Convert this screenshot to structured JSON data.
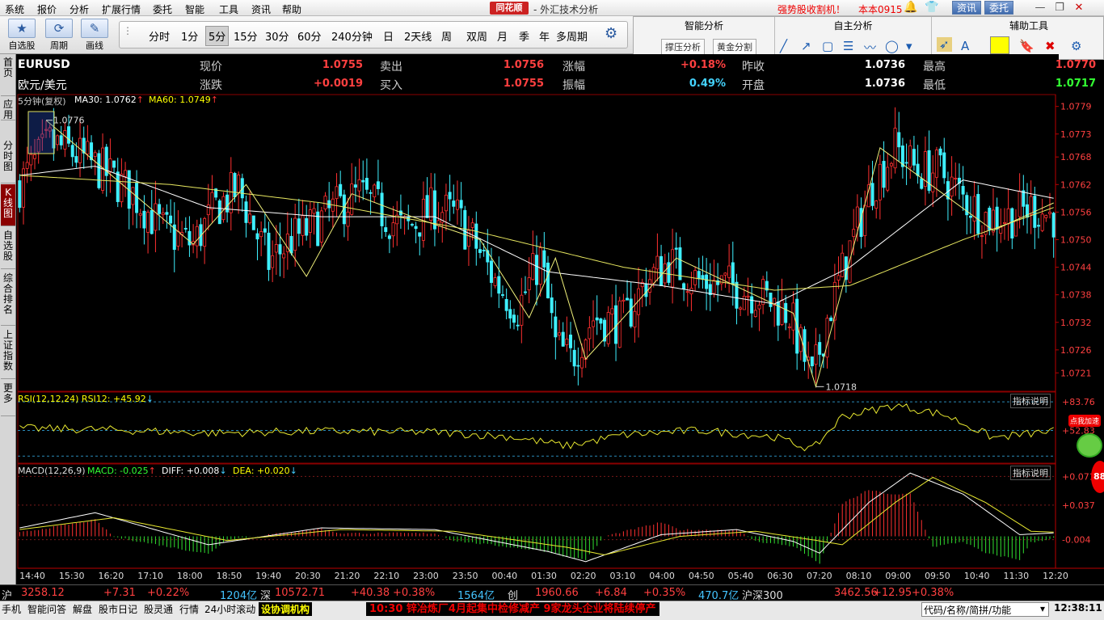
{
  "menu": [
    "系统",
    "报价",
    "分析",
    "扩展行情",
    "委托",
    "智能",
    "工具",
    "资讯",
    "帮助"
  ],
  "brand": "同花顺",
  "window_title": "- 外汇技术分析",
  "promo": "强势股收割机！",
  "version": "本本0915",
  "top_buttons": [
    "资讯",
    "委托"
  ],
  "toolbar": {
    "self_select": "自选股",
    "cycle": "周期",
    "draw": "画线"
  },
  "periods": [
    "分时",
    "1分",
    "5分",
    "15分",
    "30分",
    "60分",
    "240分钟",
    "日",
    "2天线",
    "周",
    "双周",
    "月",
    "季",
    "年",
    "多周期"
  ],
  "active_period": "5分",
  "panels": {
    "smart": "智能分析",
    "smart_btns": [
      "撑压分析",
      "黄金分割"
    ],
    "self": "自主分析",
    "aux": "辅助工具"
  },
  "sidetabs": [
    "首页",
    "应用",
    "分时图",
    "K线图",
    "自选股",
    "综合排名",
    "上证指数",
    "更多"
  ],
  "quote": {
    "code": "EURUSD",
    "name": "欧元/美元",
    "row1": [
      [
        "现价",
        "1.0755"
      ],
      [
        "卖出",
        "1.0756"
      ],
      [
        "涨幅",
        "+0.18%"
      ],
      [
        "昨收",
        "1.0736"
      ],
      [
        "最高",
        "1.0770"
      ]
    ],
    "row2": [
      [
        "涨跌",
        "+0.0019"
      ],
      [
        "买入",
        "1.0755"
      ],
      [
        "振幅",
        "0.49%"
      ],
      [
        "开盘",
        "1.0736"
      ],
      [
        "最低",
        "1.0717"
      ]
    ]
  },
  "legend": {
    "main": "5分钟(复权)",
    "ma30": "MA30: 1.0762",
    "ma60": "MA60: 1.0749",
    "rsi": "RSI(12,12,24) RSI12: +45.92",
    "macd": "MACD(12,26,9)",
    "macd_v": "MACD: -0.025",
    "diff": "DIFF: +0.008",
    "dea": "DEA: +0.020",
    "explain": "指标说明"
  },
  "price_axis": [
    "1.0779",
    "1.0773",
    "1.0768",
    "1.0762",
    "1.0756",
    "1.0750",
    "1.0744",
    "1.0738",
    "1.0732",
    "1.0726",
    "1.0721"
  ],
  "rsi_axis": [
    "83.76",
    "52.83"
  ],
  "macd_axis": [
    "0.071",
    "0.037",
    "-0.004"
  ],
  "markers": {
    "high": "1.0776",
    "low": "1.0718"
  },
  "time_axis": [
    "14:40",
    "15:30",
    "16:20",
    "17:10",
    "18:00",
    "18:50",
    "19:40",
    "20:30",
    "21:20",
    "22:10",
    "23:00",
    "23:50",
    "00:40",
    "01:30",
    "02:20",
    "03:10",
    "04:00",
    "04:50",
    "05:40",
    "06:30",
    "07:20",
    "08:10",
    "09:00",
    "09:50",
    "10:40",
    "11:30",
    "12:20"
  ],
  "status": [
    {
      "t": "沪",
      "c": "#ddd"
    },
    {
      "t": "3258.12",
      "c": "#ff4040"
    },
    {
      "t": "+7.31",
      "c": "#ff4040"
    },
    {
      "t": "+0.22%",
      "c": "#ff4040"
    },
    {
      "t": "1204亿",
      "c": "#44c4ff"
    },
    {
      "t": "深",
      "c": "#ddd"
    },
    {
      "t": "10572.71",
      "c": "#ff4040"
    },
    {
      "t": "+40.38",
      "c": "#ff4040"
    },
    {
      "t": "+0.38%",
      "c": "#ff4040"
    },
    {
      "t": "1564亿",
      "c": "#44c4ff"
    },
    {
      "t": "创",
      "c": "#ddd"
    },
    {
      "t": "1960.66",
      "c": "#ff4040"
    },
    {
      "t": "+6.84",
      "c": "#ff4040"
    },
    {
      "t": "+0.35%",
      "c": "#ff4040"
    },
    {
      "t": "470.7亿",
      "c": "#44c4ff"
    },
    {
      "t": "沪深300",
      "c": "#ddd"
    },
    {
      "t": "3462.56",
      "c": "#ff4040"
    },
    {
      "t": "+12.95",
      "c": "#ff4040"
    },
    {
      "t": "+0.38%",
      "c": "#ff4040"
    }
  ],
  "bottom": [
    "手机",
    "智能问答",
    "解盘",
    "股市日记",
    "股灵通",
    "行情",
    "24小时滚动",
    "设协调机构"
  ],
  "ticker": "10:30 锌冶炼厂4月起集中检修减产 9家龙头企业将陆续停产",
  "search_label": "代码/名称/简拼/功能",
  "clock": "12:38:11",
  "float_badge": "88",
  "float_tip": "点我加速",
  "chart_data": {
    "type": "candlestick",
    "ylim": [
      1.0717,
      1.078
    ],
    "high_marker": 1.0776,
    "low_marker": 1.0718,
    "anchors": [
      [
        0,
        1.0762
      ],
      [
        8,
        1.0771
      ],
      [
        14,
        1.0769
      ],
      [
        22,
        1.0765
      ],
      [
        30,
        1.076
      ],
      [
        38,
        1.0752
      ],
      [
        46,
        1.0749
      ],
      [
        52,
        1.0757
      ],
      [
        58,
        1.0761
      ],
      [
        66,
        1.0745
      ],
      [
        72,
        1.075
      ],
      [
        78,
        1.0753
      ],
      [
        84,
        1.0757
      ],
      [
        90,
        1.076
      ],
      [
        96,
        1.0756
      ],
      [
        102,
        1.0752
      ],
      [
        110,
        1.0757
      ],
      [
        116,
        1.0755
      ],
      [
        120,
        1.075
      ],
      [
        126,
        1.0741
      ],
      [
        132,
        1.0735
      ],
      [
        138,
        1.0746
      ],
      [
        142,
        1.0727
      ],
      [
        146,
        1.0724
      ],
      [
        152,
        1.0733
      ],
      [
        160,
        1.0732
      ],
      [
        166,
        1.0741
      ],
      [
        172,
        1.0745
      ],
      [
        180,
        1.0741
      ],
      [
        188,
        1.074
      ],
      [
        196,
        1.0738
      ],
      [
        204,
        1.0734
      ],
      [
        210,
        1.0719
      ],
      [
        214,
        1.0733
      ],
      [
        220,
        1.0748
      ],
      [
        226,
        1.0762
      ],
      [
        232,
        1.077
      ],
      [
        238,
        1.0765
      ],
      [
        244,
        1.0765
      ],
      [
        250,
        1.0759
      ],
      [
        256,
        1.0755
      ],
      [
        262,
        1.0755
      ],
      [
        268,
        1.0757
      ],
      [
        274,
        1.0755
      ]
    ],
    "ma_fast": [
      [
        0,
        1.0764
      ],
      [
        20,
        1.0766
      ],
      [
        50,
        1.0757
      ],
      [
        80,
        1.0755
      ],
      [
        110,
        1.0755
      ],
      [
        140,
        1.0743
      ],
      [
        170,
        1.074
      ],
      [
        200,
        1.0736
      ],
      [
        220,
        1.0744
      ],
      [
        250,
        1.0763
      ],
      [
        274,
        1.0759
      ]
    ],
    "ma_slow": [
      [
        0,
        1.0764
      ],
      [
        40,
        1.0762
      ],
      [
        80,
        1.0758
      ],
      [
        120,
        1.0752
      ],
      [
        160,
        1.0744
      ],
      [
        200,
        1.0739
      ],
      [
        220,
        1.074
      ],
      [
        250,
        1.075
      ],
      [
        274,
        1.0757
      ]
    ],
    "zigzag": [
      [
        7,
        1.0776
      ],
      [
        46,
        1.0749
      ],
      [
        60,
        1.0762
      ],
      [
        76,
        1.0742
      ],
      [
        88,
        1.076
      ],
      [
        104,
        1.0755
      ],
      [
        122,
        1.075
      ],
      [
        135,
        1.0733
      ],
      [
        142,
        1.0746
      ],
      [
        150,
        1.0724
      ],
      [
        160,
        1.0733
      ],
      [
        174,
        1.0746
      ],
      [
        205,
        1.0734
      ],
      [
        211,
        1.0718
      ],
      [
        228,
        1.077
      ],
      [
        258,
        1.0752
      ],
      [
        274,
        1.0758
      ]
    ],
    "rsi_series": [
      [
        0,
        55
      ],
      [
        20,
        54
      ],
      [
        50,
        50
      ],
      [
        80,
        52
      ],
      [
        110,
        51
      ],
      [
        130,
        46
      ],
      [
        145,
        36
      ],
      [
        160,
        48
      ],
      [
        180,
        53
      ],
      [
        200,
        46
      ],
      [
        210,
        32
      ],
      [
        218,
        68
      ],
      [
        232,
        80
      ],
      [
        245,
        70
      ],
      [
        258,
        45
      ],
      [
        274,
        52
      ]
    ],
    "macd_diff": [
      [
        0,
        0.01
      ],
      [
        20,
        0.028
      ],
      [
        50,
        -0.01
      ],
      [
        80,
        0.01
      ],
      [
        110,
        0.008
      ],
      [
        140,
        -0.018
      ],
      [
        150,
        -0.03
      ],
      [
        170,
        0.002
      ],
      [
        190,
        0.008
      ],
      [
        205,
        -0.006
      ],
      [
        212,
        -0.02
      ],
      [
        225,
        0.04
      ],
      [
        236,
        0.075
      ],
      [
        250,
        0.05
      ],
      [
        265,
        0.002
      ],
      [
        274,
        0.004
      ]
    ],
    "macd_dea": [
      [
        0,
        0.008
      ],
      [
        25,
        0.022
      ],
      [
        55,
        -0.005
      ],
      [
        85,
        0.008
      ],
      [
        115,
        0.006
      ],
      [
        145,
        -0.013
      ],
      [
        155,
        -0.022
      ],
      [
        175,
        0.0
      ],
      [
        195,
        0.006
      ],
      [
        210,
        -0.004
      ],
      [
        218,
        -0.01
      ],
      [
        232,
        0.04
      ],
      [
        242,
        0.07
      ],
      [
        256,
        0.04
      ],
      [
        268,
        0.006
      ],
      [
        274,
        0.005
      ]
    ]
  }
}
